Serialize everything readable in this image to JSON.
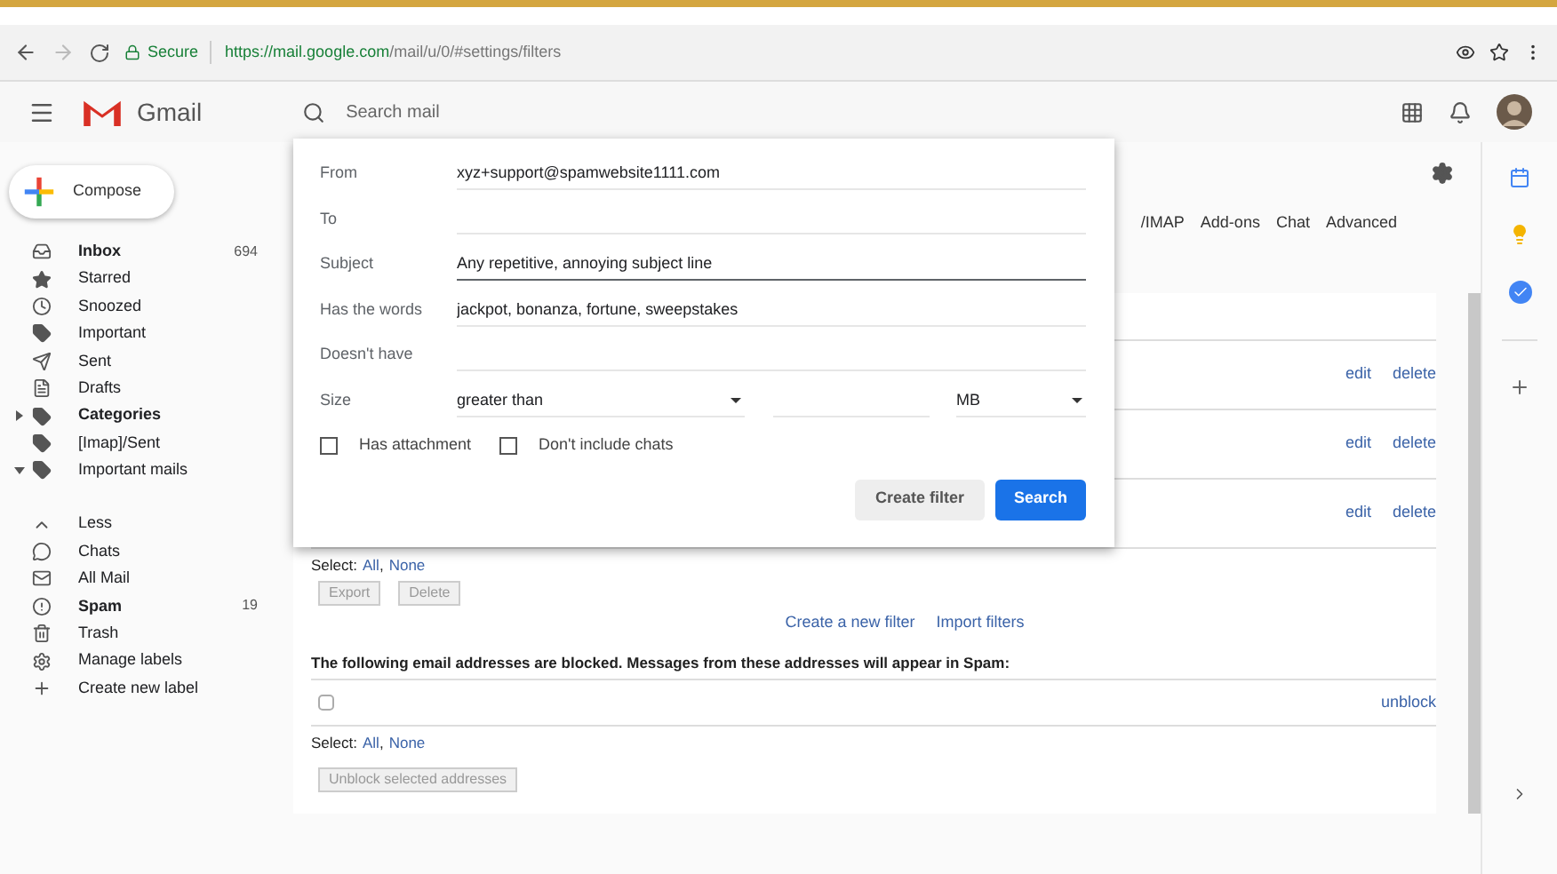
{
  "browser": {
    "secure_label": "Secure",
    "url_host": "https://mail.google.com",
    "url_path": "/mail/u/0/#settings/filters"
  },
  "header": {
    "app_name": "Gmail",
    "search": {
      "placeholder": "Search mail"
    }
  },
  "compose": {
    "label": "Compose"
  },
  "sidebar": {
    "items": [
      {
        "label": "Inbox",
        "count": "694",
        "bold": true
      },
      {
        "label": "Starred",
        "bold": false
      },
      {
        "label": "Snoozed",
        "bold": false
      },
      {
        "label": "Important",
        "bold": false
      },
      {
        "label": "Sent",
        "bold": false
      },
      {
        "label": "Drafts",
        "bold": false
      },
      {
        "label": "Categories",
        "bold": true,
        "expanded": false
      },
      {
        "label": "[Imap]/Sent",
        "bold": false
      },
      {
        "label": "Important mails",
        "bold": false,
        "expanded": true
      }
    ],
    "more_items": [
      {
        "label": "Less",
        "bold": false
      },
      {
        "label": "Chats",
        "bold": false
      },
      {
        "label": "All Mail",
        "bold": false
      },
      {
        "label": "Spam",
        "count": "19",
        "bold": true
      },
      {
        "label": "Trash",
        "bold": false
      },
      {
        "label": "Manage labels",
        "bold": false
      },
      {
        "label": "Create new label",
        "bold": false
      }
    ]
  },
  "settings_tabs": [
    "/IMAP",
    "Add-ons",
    "Chat",
    "Advanced"
  ],
  "filters": [
    {
      "edit": "edit",
      "delete": "delete"
    },
    {
      "edit": "edit",
      "delete": "delete"
    },
    {
      "edit": "edit",
      "delete": "delete"
    }
  ],
  "filters_footer": {
    "select_label": "Select:",
    "all": "All",
    "separator": ",",
    "none": "None",
    "buttons": [
      "Export",
      "Delete"
    ],
    "links": [
      "Create a new filter",
      "Import filters"
    ]
  },
  "blocked": {
    "heading": "The following email addresses are blocked. Messages from these addresses will appear in Spam:",
    "rows": [
      {
        "checked": false,
        "action": "unblock"
      }
    ],
    "select_label": "Select:",
    "all": "All",
    "separator": ",",
    "none": "None",
    "button": "Unblock selected addresses"
  },
  "search_popup": {
    "fields": [
      {
        "label": "From",
        "value": "xyz+support@spamwebsite1111.com",
        "focused": false
      },
      {
        "label": "To",
        "focused": false
      },
      {
        "label": "Subject",
        "value": "Any repetitive, annoying subject line",
        "focused": true
      },
      {
        "label": "Has the words",
        "value": "jackpot, bonanza, fortune, sweepstakes",
        "focused": false
      },
      {
        "label": "Doesn't have",
        "focused": false
      }
    ],
    "size": {
      "label": "Size",
      "operator": "greater than",
      "unit": "MB"
    },
    "checkboxes": [
      {
        "label": "Has attachment",
        "checked": false
      },
      {
        "label": "Don't include chats",
        "checked": false
      }
    ],
    "buttons": [
      "Create filter",
      "Search"
    ]
  }
}
